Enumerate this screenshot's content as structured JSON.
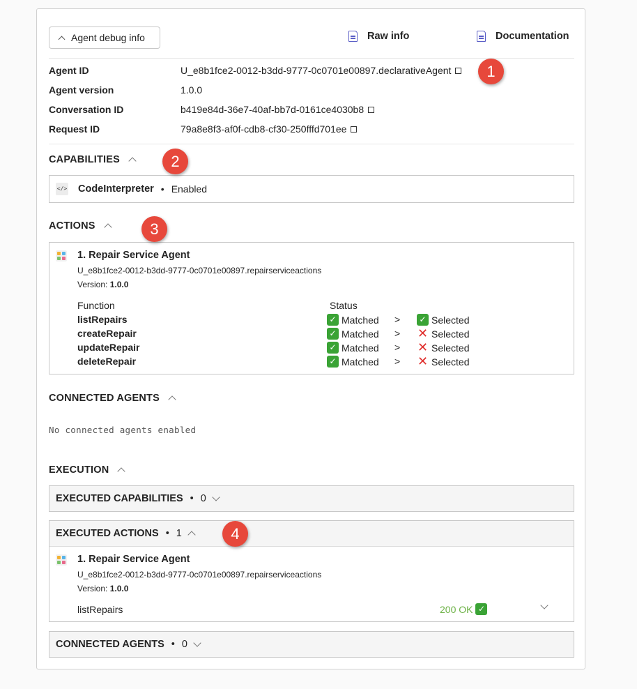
{
  "header": {
    "debug_button": "Agent debug info",
    "raw_info": "Raw info",
    "documentation": "Documentation"
  },
  "info": [
    {
      "label": "Agent ID",
      "value": "U_e8b1fce2-0012-b3dd-9777-0c0701e00897.declarativeAgent"
    },
    {
      "label": "Agent version",
      "value": "1.0.0"
    },
    {
      "label": "Conversation ID",
      "value": "b419e84d-36e7-40af-bb7d-0161ce4030b8"
    },
    {
      "label": "Request ID",
      "value": "79a8e8f3-af0f-cdb8-cf30-250fffd701ee"
    }
  ],
  "capabilities": {
    "title": "CAPABILITIES",
    "item": {
      "name": "CodeInterpreter",
      "sep": "•",
      "state": "Enabled",
      "icon": "code-icon"
    }
  },
  "actions": {
    "title": "ACTIONS",
    "agent": {
      "name": "1. Repair Service Agent",
      "id": "U_e8b1fce2-0012-b3dd-9777-0c0701e00897.repairserviceactions",
      "version_label": "Version:",
      "version": "1.0.0"
    },
    "col_function": "Function",
    "col_status": "Status",
    "functions": [
      {
        "name": "listRepairs",
        "matched": "Matched",
        "gt": ">",
        "selected": "Selected",
        "selected_ok": true
      },
      {
        "name": "createRepair",
        "matched": "Matched",
        "gt": ">",
        "selected": "Selected",
        "selected_ok": false
      },
      {
        "name": "updateRepair",
        "matched": "Matched",
        "gt": ">",
        "selected": "Selected",
        "selected_ok": false
      },
      {
        "name": "deleteRepair",
        "matched": "Matched",
        "gt": ">",
        "selected": "Selected",
        "selected_ok": false
      }
    ]
  },
  "connected_agents": {
    "title": "CONNECTED AGENTS",
    "empty": "No connected agents enabled"
  },
  "execution": {
    "title": "EXECUTION",
    "executed_capabilities": {
      "title": "EXECUTED CAPABILITIES",
      "sep": "•",
      "count": "0"
    },
    "executed_actions": {
      "title": "EXECUTED ACTIONS",
      "sep": "•",
      "count": "1",
      "agent": {
        "name": "1. Repair Service Agent",
        "id": "U_e8b1fce2-0012-b3dd-9777-0c0701e00897.repairserviceactions",
        "version_label": "Version:",
        "version": "1.0.0"
      },
      "call": {
        "name": "listRepairs",
        "status": "200 OK"
      }
    },
    "connected_agents": {
      "title": "CONNECTED AGENTS",
      "sep": "•",
      "count": "0"
    }
  },
  "callouts": [
    "1",
    "2",
    "3",
    "4"
  ],
  "colors": {
    "accent": "#5b5fc7",
    "ok": "#3aa335",
    "error": "#e0302e",
    "callout": "#e7483b",
    "status_ok_text": "#6bb144"
  }
}
